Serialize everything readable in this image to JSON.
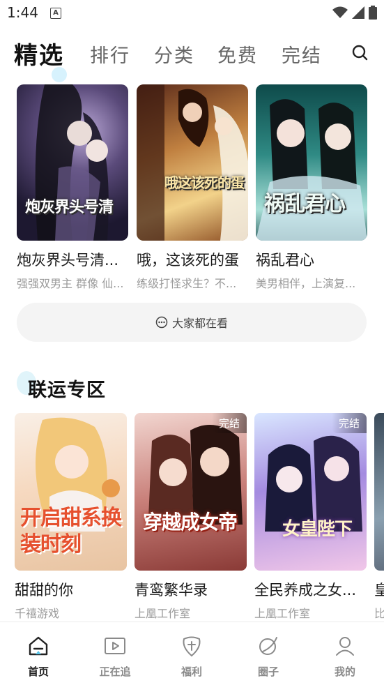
{
  "status_bar": {
    "time": "1:44",
    "notif_icon": "A"
  },
  "tabs": [
    {
      "label": "精选",
      "active": true
    },
    {
      "label": "排行",
      "active": false
    },
    {
      "label": "分类",
      "active": false
    },
    {
      "label": "免费",
      "active": false
    },
    {
      "label": "完结",
      "active": false
    }
  ],
  "featured": [
    {
      "title": "炮灰界头号清...",
      "subtitle": "强强双男主 群像 仙...",
      "cover_text": "炮灰界头号清"
    },
    {
      "title": "哦，这该死的蛋",
      "subtitle": "练级打怪求生？不...",
      "cover_text": "哦这该死的蛋"
    },
    {
      "title": "祸乱君心",
      "subtitle": "美男相伴，上演复...",
      "cover_text": "祸乱君心"
    }
  ],
  "watch_button": {
    "label": "大家都在看"
  },
  "section": {
    "title": "联运专区"
  },
  "games": [
    {
      "title": "甜甜的你",
      "subtitle": "千禧游戏",
      "badge": "",
      "cover_text": "开启甜系换装时刻"
    },
    {
      "title": "青鸾繁华录",
      "subtitle": "上凰工作室",
      "badge": "完结",
      "cover_text": "穿越成女帝"
    },
    {
      "title": "全民养成之女...",
      "subtitle": "上凰工作室",
      "badge": "完结",
      "cover_text": "女皇陛下"
    },
    {
      "title": "皇",
      "subtitle": "比",
      "badge": "",
      "cover_text": ""
    }
  ],
  "bottom_nav": [
    {
      "label": "首页",
      "icon": "home-icon",
      "active": true
    },
    {
      "label": "正在追",
      "icon": "play-icon",
      "active": false
    },
    {
      "label": "福利",
      "icon": "gift-icon",
      "active": false
    },
    {
      "label": "圈子",
      "icon": "circle-icon",
      "active": false
    },
    {
      "label": "我的",
      "icon": "profile-icon",
      "active": false
    }
  ],
  "colors": {
    "accent_deco": "#cdeffc",
    "text_primary": "#111111",
    "text_secondary": "#9a9a9a"
  }
}
